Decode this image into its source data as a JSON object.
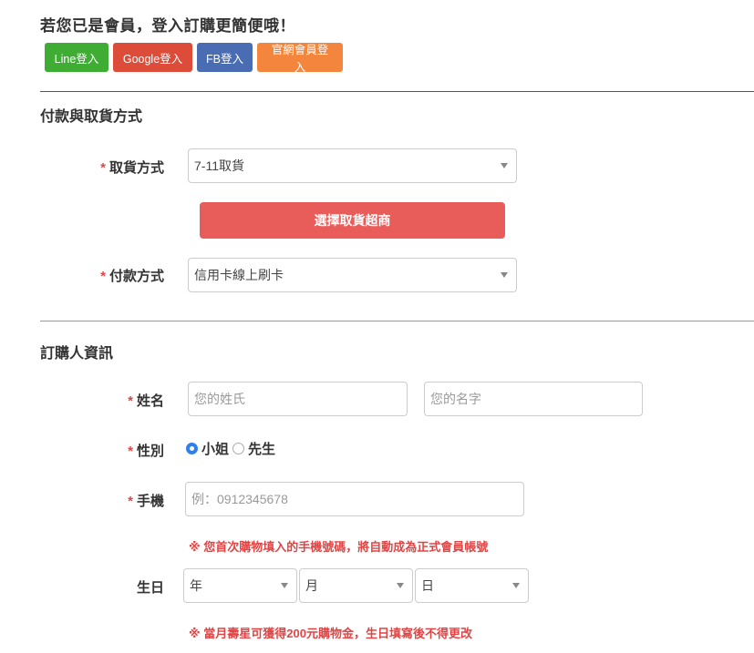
{
  "login": {
    "title": "若您已是會員，登入訂購更簡便哦！",
    "buttons": {
      "line": "Line登入",
      "google": "Google登入",
      "fb": "FB登入",
      "member": "官網會員登入"
    }
  },
  "payment_section": {
    "title": "付款與取貨方式",
    "pickup": {
      "required_mark": "*",
      "label": "取貨方式",
      "value": "7-11取貨"
    },
    "store_button": "選擇取貨超商",
    "payment": {
      "required_mark": "*",
      "label": "付款方式",
      "value": "信用卡線上刷卡"
    }
  },
  "buyer_section": {
    "title": "訂購人資訊",
    "name": {
      "required_mark": "*",
      "label": "姓名",
      "last_placeholder": "您的姓氏",
      "first_placeholder": "您的名字"
    },
    "gender": {
      "required_mark": "*",
      "label": "性別",
      "options": [
        "小姐",
        "先生"
      ],
      "selected": "小姐"
    },
    "phone": {
      "required_mark": "*",
      "label": "手機",
      "placeholder": "例：0912345678",
      "note": "※ 您首次購物填入的手機號碼，將自動成為正式會員帳號"
    },
    "birthday": {
      "label": "生日",
      "year": "年",
      "month": "月",
      "day": "日",
      "note": "※ 當月壽星可獲得200元購物金，生日填寫後不得更改"
    }
  },
  "colors": {
    "line": "#3fad34",
    "google": "#dd4b39",
    "fb": "#4a6cb3",
    "member": "#f3863c",
    "store_button": "#e85c5a",
    "required": "#e04545",
    "radio_checked": "#2f80ed"
  }
}
